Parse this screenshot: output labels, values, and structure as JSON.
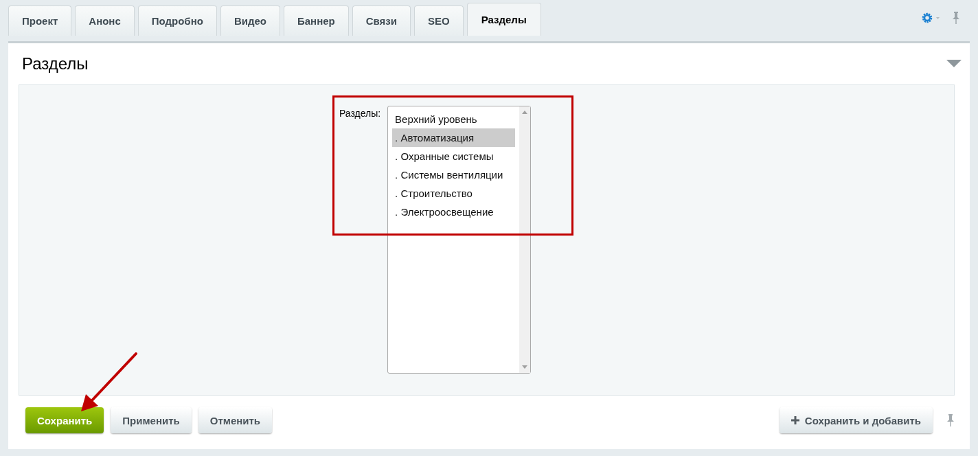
{
  "tabs": [
    {
      "label": "Проект",
      "selected": false
    },
    {
      "label": "Анонс",
      "selected": false
    },
    {
      "label": "Подробно",
      "selected": false
    },
    {
      "label": "Видео",
      "selected": false
    },
    {
      "label": "Баннер",
      "selected": false
    },
    {
      "label": "Связи",
      "selected": false
    },
    {
      "label": "SEO",
      "selected": false
    },
    {
      "label": "Разделы",
      "selected": true
    }
  ],
  "section": {
    "title": "Разделы",
    "field": {
      "label": "Разделы:",
      "options": [
        {
          "text": "Верхний уровень",
          "selected": false
        },
        {
          "text": ". Автоматизация",
          "selected": true
        },
        {
          "text": ". Охранные системы",
          "selected": false
        },
        {
          "text": ". Системы вентиляции",
          "selected": false
        },
        {
          "text": ". Строительство",
          "selected": false
        },
        {
          "text": ". Электроосвещение",
          "selected": false
        }
      ]
    }
  },
  "buttons": [
    {
      "label": "Сохранить",
      "kind": "primary"
    },
    {
      "label": "Применить",
      "kind": "normal"
    },
    {
      "label": "Отменить",
      "kind": "normal"
    },
    {
      "label": "Сохранить и добавить",
      "kind": "add"
    }
  ]
}
